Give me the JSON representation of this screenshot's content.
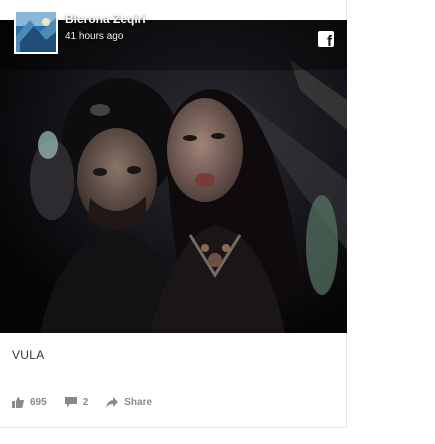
{
  "post": {
    "author": "Blerona Zeqiri",
    "timestamp": "41 hours ago",
    "caption": "VULA",
    "source_icon": "facebook-icon",
    "photo_description_icon": "photo-image"
  },
  "stats": {
    "likes": "695",
    "comments": "2",
    "share_label": "Share"
  },
  "colors": {
    "photo_bg": "#060608",
    "action_text": "#8a8a8a",
    "caption_text": "#333333"
  }
}
